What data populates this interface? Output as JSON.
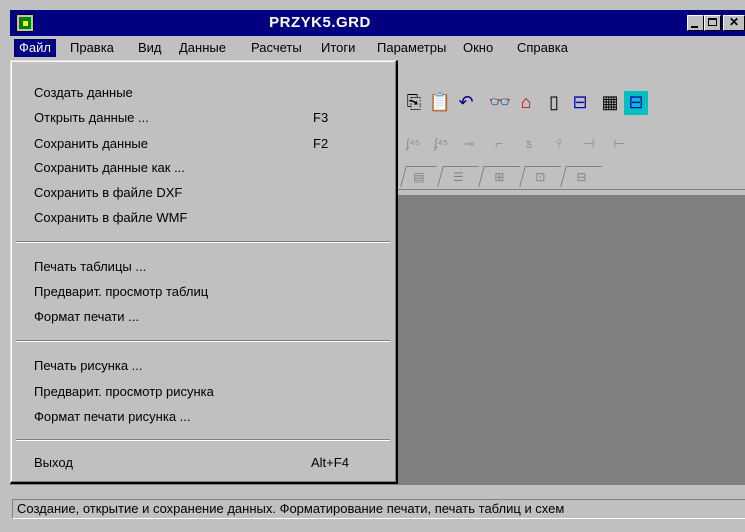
{
  "window": {
    "title": "PRZYK5.GRD",
    "minimize": "minimize",
    "maximize": "maximize",
    "close": "✕"
  },
  "menubar": {
    "items": [
      {
        "label": "Файл",
        "active": true
      },
      {
        "label": "Правка"
      },
      {
        "label": "Вид"
      },
      {
        "label": "Данные"
      },
      {
        "label": "Расчеты"
      },
      {
        "label": "Итоги"
      },
      {
        "label": "Параметры"
      },
      {
        "label": "Окно"
      },
      {
        "label": "Справка"
      }
    ]
  },
  "file_menu": {
    "group1": [
      {
        "label": "Создать данные",
        "shortcut": ""
      },
      {
        "label": "Открыть данные ...",
        "shortcut": "F3"
      },
      {
        "label": "Сохранить данные",
        "shortcut": "F2"
      },
      {
        "label": "Сохранить данные как ...",
        "shortcut": ""
      },
      {
        "label": "Сохранить в файле DXF",
        "shortcut": ""
      },
      {
        "label": "Сохранить в файле WMF",
        "shortcut": ""
      }
    ],
    "group2": [
      {
        "label": "Печать таблицы ...",
        "shortcut": ""
      },
      {
        "label": "Предварит. просмотр таблиц",
        "shortcut": ""
      },
      {
        "label": "Формат печати ...",
        "shortcut": ""
      }
    ],
    "group3": [
      {
        "label": "Печать рисунка ...",
        "shortcut": ""
      },
      {
        "label": "Предварит. просмотр рисунка",
        "shortcut": ""
      },
      {
        "label": "Формат печати рисунка ...",
        "shortcut": ""
      }
    ],
    "group4": [
      {
        "label": "Выход",
        "shortcut": "Alt+F4"
      }
    ]
  },
  "statusbar": {
    "text": "Создание, открытие и сохранение данных. Форматирование печати, печать таблиц и схем"
  },
  "colors": {
    "title_bg": "#000080",
    "face": "#c0c0c0",
    "workspace": "#808080"
  }
}
